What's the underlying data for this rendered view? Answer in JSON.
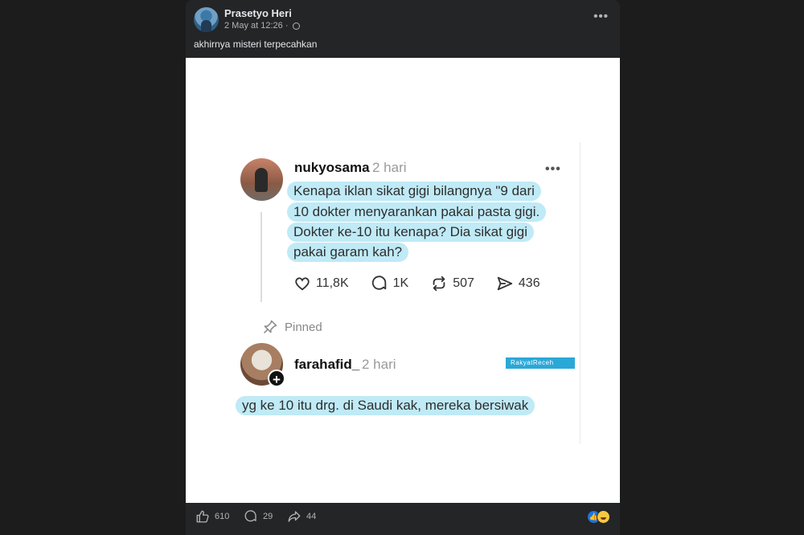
{
  "post": {
    "author": "Prasetyo Heri",
    "timestamp": "2 May at 12:26 ·",
    "caption": "akhirnya misteri terpecahkan",
    "more_label": "•••"
  },
  "thread": {
    "post1": {
      "username": "nukyosama",
      "time": "2 hari",
      "more_label": "•••",
      "lines": [
        "Kenapa iklan sikat gigi bilangnya \"9 dari",
        "10 dokter menyarankan pakai pasta gigi.",
        "Dokter ke-10 itu kenapa? Dia sikat gigi",
        "pakai garam kah?"
      ],
      "likes": "11,8K",
      "replies": "1K",
      "reposts": "507",
      "shares": "436"
    },
    "pinned_label": "Pinned",
    "post2": {
      "username": "farahafid_",
      "time": "2 hari",
      "watermark": "RakyatReceh",
      "line": "yg ke 10 itu drg. di Saudi kak, mereka bersiwak"
    }
  },
  "footer": {
    "likes": "610",
    "comments": "29",
    "shares": "44"
  },
  "colors": {
    "background": "#1c1c1d",
    "card": "#242526",
    "highlight": "#bfeaf6",
    "like_blue": "#1b74e4"
  }
}
